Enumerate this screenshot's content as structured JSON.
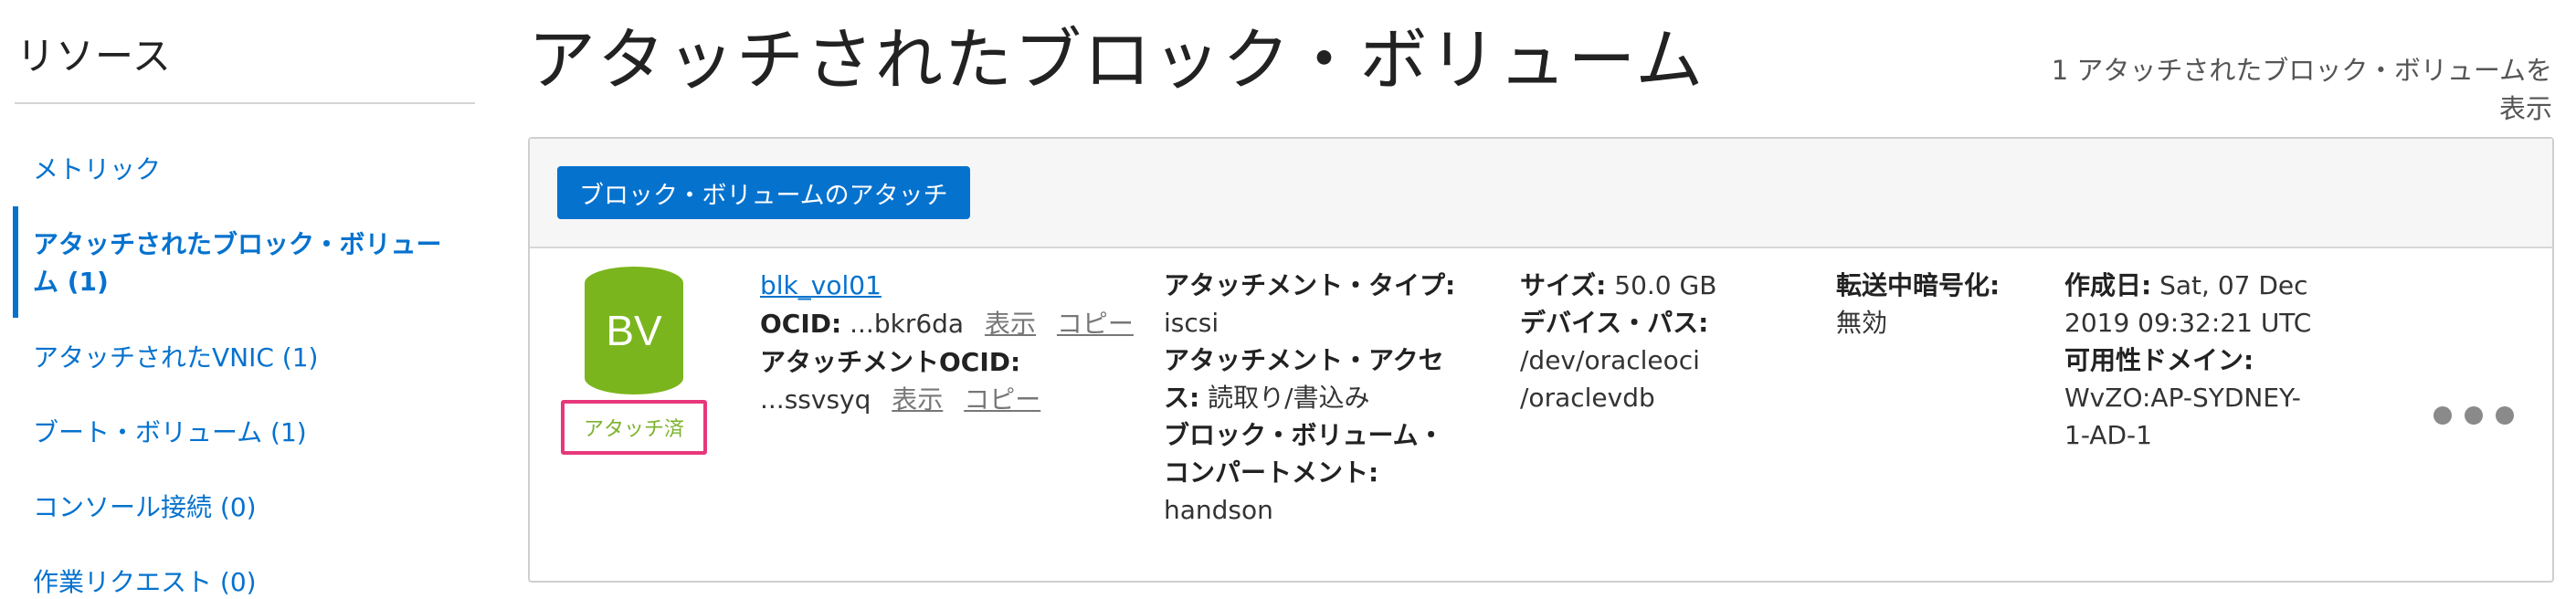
{
  "sidebar": {
    "heading": "リソース",
    "items": [
      {
        "label": "メトリック"
      },
      {
        "label": "アタッチされたブロック・ボリューム (1)"
      },
      {
        "label": "アタッチされたVNIC (1)"
      },
      {
        "label": "ブート・ボリューム (1)"
      },
      {
        "label": "コンソール接続 (0)"
      },
      {
        "label": "作業リクエスト (0)"
      }
    ],
    "active_index": 1
  },
  "header": {
    "title": "アタッチされたブロック・ボリューム",
    "count_text": "1 アタッチされたブロック・ボリュームを表示"
  },
  "toolbar": {
    "attach_button": "ブロック・ボリュームのアタッチ"
  },
  "volume": {
    "icon_text": "BV",
    "status": "アタッチ済",
    "name": "blk_vol01",
    "ocid_label": "OCID:",
    "ocid_value": "...bkr6da",
    "show_label": "表示",
    "copy_label": "コピー",
    "attachment_ocid_label": "アタッチメントOCID:",
    "attachment_ocid_value": "...ssvsyq",
    "attachment_type_label": "アタッチメント・タイプ:",
    "attachment_type_value": "iscsi",
    "access_label_1": "アタッチメント・アクセ",
    "access_label_2": "ス:",
    "access_value": "読取り/書込み",
    "compartment_label_1": "ブロック・ボリューム・",
    "compartment_label_2": "コンパートメント:",
    "compartment_value": "handson",
    "size_label": "サイズ:",
    "size_value": "50.0 GB",
    "device_path_label": "デバイス・パス:",
    "device_path_line1": "/dev/oracleoci",
    "device_path_line2": "/oraclevdb",
    "encryption_label": "転送中暗号化:",
    "encryption_value": "無効",
    "created_label": "作成日:",
    "created_value": "Sat, 07 Dec",
    "created_value_2": "2019 09:32:21 UTC",
    "ad_label": "可用性ドメイン:",
    "ad_value_1": "WvZO:AP-SYDNEY-",
    "ad_value_2": "1-AD-1"
  },
  "colors": {
    "accent": "#0572ce",
    "volume_green": "#7ab51d",
    "status_highlight": "#e6387a"
  },
  "icons": {
    "volume": "block-volume-cylinder-icon",
    "more": "more-actions-icon"
  }
}
